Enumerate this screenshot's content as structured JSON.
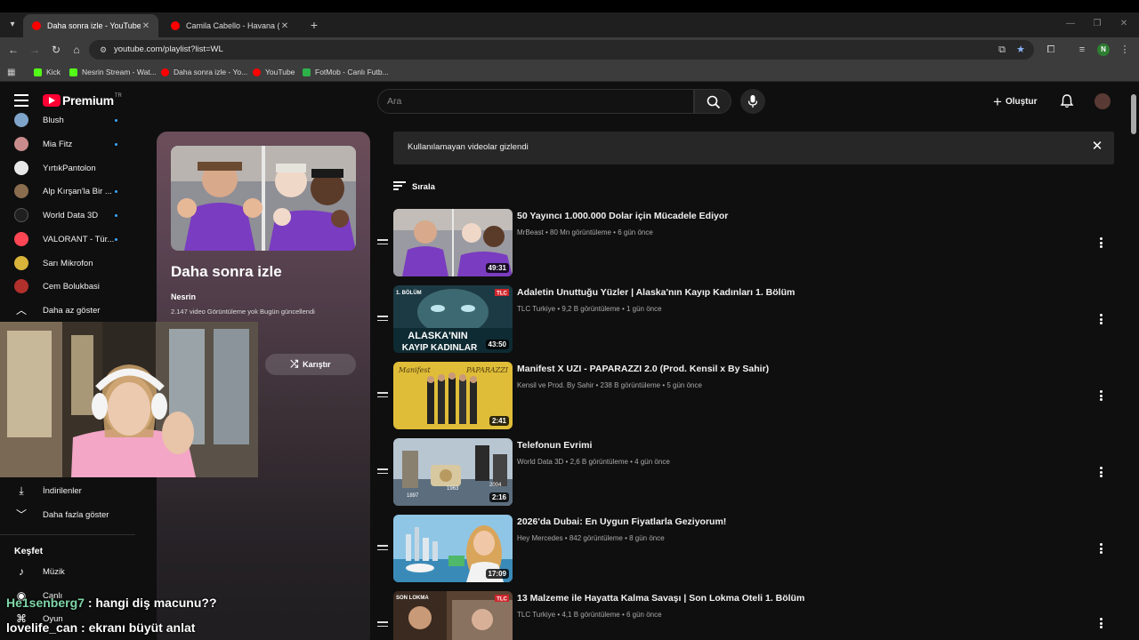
{
  "browser": {
    "tabs": [
      {
        "title": "Daha sonra izle - YouTube",
        "active": true
      },
      {
        "title": "Camila Cabello - Havana (Lyrics",
        "active": false
      }
    ],
    "url": "youtube.com/playlist?list=WL",
    "profile_initial": "N",
    "bookmarks": [
      "Kick",
      "Nesrin Stream - Wat...",
      "Daha sonra izle - Yo...",
      "YouTube",
      "FotMob - Canlı Futb..."
    ]
  },
  "header": {
    "logo_text": "Premium",
    "logo_badge": "TR",
    "search_placeholder": "Ara",
    "create_label": "Oluştur"
  },
  "sidebar": {
    "subscriptions": [
      {
        "name": "Blush",
        "color": "#7fa4c9",
        "new": true
      },
      {
        "name": "Mia Fitz",
        "color": "#c98c8c",
        "new": true
      },
      {
        "name": "YırtıkPantolon",
        "color": "#e8e8e8",
        "new": false
      },
      {
        "name": "Alp Kırşan'la Bir ...",
        "color": "#8a6d4f",
        "new": true
      },
      {
        "name": "World Data 3D",
        "color": "#1f1f1f",
        "new": true
      },
      {
        "name": "VALORANT - Tür...",
        "color": "#ff4655",
        "new": true
      },
      {
        "name": "Sarı Mikrofon",
        "color": "#d8b43a",
        "new": false
      },
      {
        "name": "Cem Bolukbasi",
        "color": "#b0302c",
        "new": false
      }
    ],
    "show_less": "Daha az göster",
    "downloads": "İndirilenler",
    "show_more": "Daha fazla göster",
    "explore_title": "Keşfet",
    "explore": [
      "Müzik",
      "Canlı",
      "Oyun"
    ]
  },
  "playlist": {
    "title": "Daha sonra izle",
    "owner": "Nesrin",
    "meta": "2.147 video   Görüntüleme yok   Bugün güncellendi",
    "shuffle_label": "Karıştır"
  },
  "banner": {
    "text": "Kullanılamayan videolar gizlendi"
  },
  "sort_label": "Sırala",
  "videos": [
    {
      "title": "50 Yayıncı 1.000.000 Dolar için Mücadele Ediyor",
      "meta": "MrBeast • 80 Mn görüntüleme • 6 gün önce",
      "duration": "49:31",
      "color": "#6c3aa8"
    },
    {
      "title": "Adaletin Unuttuğu Yüzler | Alaska'nın Kayıp Kadınları 1. Bölüm",
      "meta": "TLC Turkiye • 9,2 B görüntüleme • 1 gün önce",
      "duration": "43:50",
      "color": "#2a5a6a"
    },
    {
      "title": "Manifest X UZI - PAPARAZZI 2.0 (Prod. Kensil x By Sahir)",
      "meta": "Kensil ve Prod. By Sahir • 238 B görüntüleme • 5 gün önce",
      "duration": "2:41",
      "color": "#d9b531"
    },
    {
      "title": "Telefonun Evrimi",
      "meta": "World Data 3D • 2,6 B görüntüleme • 4 gün önce",
      "duration": "2:16",
      "color": "#6f8aa3"
    },
    {
      "title": "2026'da Dubai: En Uygun Fiyatlarla Geziyorum!",
      "meta": "Hey Mercedes • 842 görüntüleme • 8 gün önce",
      "duration": "17:09",
      "color": "#5fa3c9"
    },
    {
      "title": "13 Malzeme ile Hayatta Kalma Savaşı | Son Lokma Oteli 1. Bölüm",
      "meta": "TLC Turkiye • 4,1 B görüntüleme • 6 gün önce",
      "duration": "",
      "color": "#6a4b3a"
    }
  ],
  "chat": [
    {
      "user": "He1senberg7",
      "message": ": hangi diş macunu??"
    },
    {
      "user": "lovelife_can",
      "message": ": ekranı büyüt anlat"
    }
  ]
}
